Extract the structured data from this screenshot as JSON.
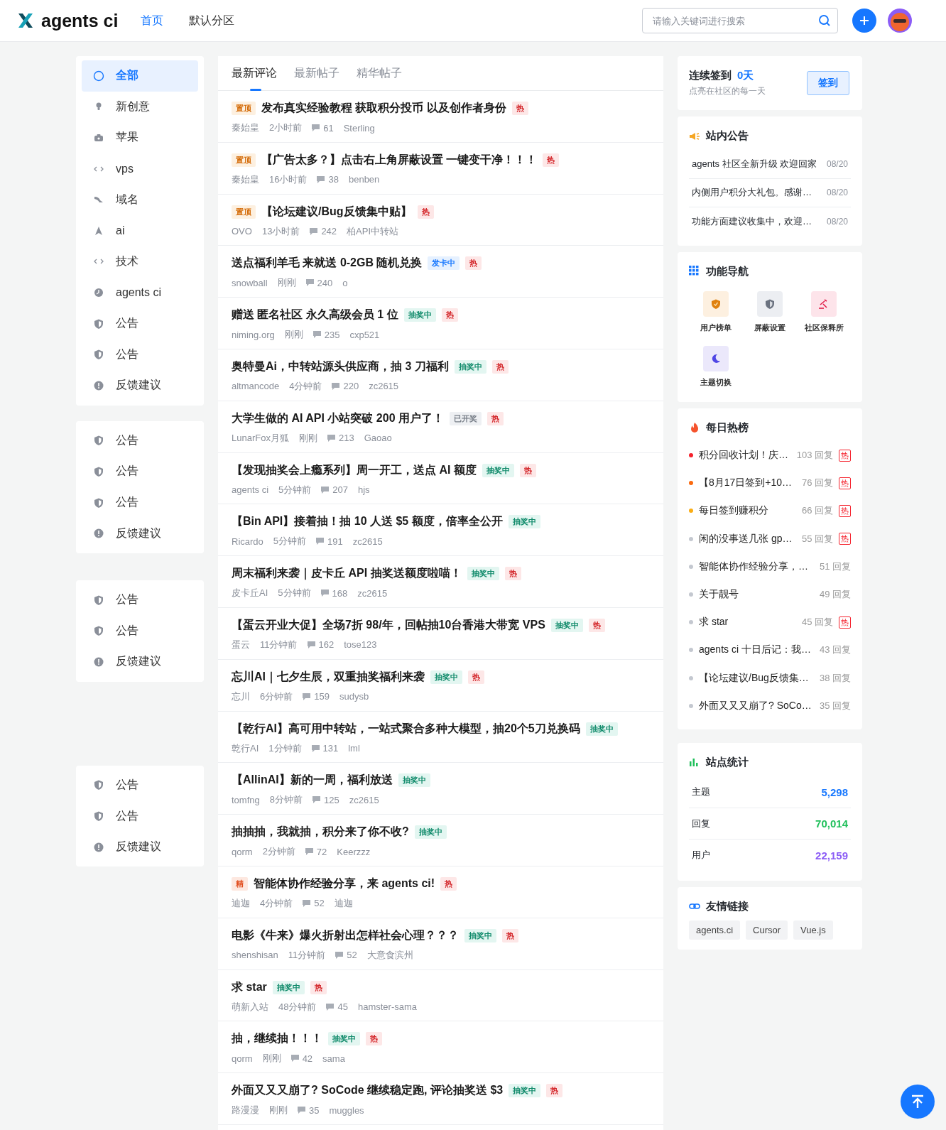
{
  "header": {
    "logo": "agents ci",
    "nav": [
      {
        "label": "首页",
        "selected": true
      },
      {
        "label": "默认分区",
        "selected": false
      }
    ],
    "search": {
      "placeholder": "请输入关键词进行搜索"
    }
  },
  "sidebar": {
    "groups": [
      {
        "items": [
          {
            "label": "全部",
            "kind": "all",
            "selected": true
          },
          {
            "label": "新创意",
            "kind": "bulb",
            "selected": false
          },
          {
            "label": "苹果",
            "kind": "bag",
            "selected": false
          },
          {
            "label": "vps",
            "kind": "code",
            "selected": false
          },
          {
            "label": "域名",
            "kind": "plane",
            "selected": false
          },
          {
            "label": "ai",
            "kind": "arrow",
            "selected": false
          },
          {
            "label": "技术",
            "kind": "code",
            "selected": false
          },
          {
            "label": "agents ci",
            "kind": "clock",
            "selected": false
          },
          {
            "label": "公告",
            "kind": "shield",
            "selected": false
          },
          {
            "label": "公告",
            "kind": "shield",
            "selected": false
          },
          {
            "label": "反馈建议",
            "kind": "alert",
            "selected": false
          }
        ]
      },
      {
        "items": [
          {
            "label": "公告",
            "kind": "shield",
            "selected": false
          },
          {
            "label": "公告",
            "kind": "shield",
            "selected": false
          },
          {
            "label": "公告",
            "kind": "shield",
            "selected": false
          },
          {
            "label": "反馈建议",
            "kind": "alert",
            "selected": false
          }
        ]
      },
      {
        "items": [
          {
            "label": "公告",
            "kind": "shield",
            "selected": false
          },
          {
            "label": "公告",
            "kind": "shield",
            "selected": false
          },
          {
            "label": "反馈建议",
            "kind": "alert",
            "selected": false
          }
        ]
      },
      {
        "items": [
          {
            "label": "公告",
            "kind": "shield",
            "selected": false
          },
          {
            "label": "公告",
            "kind": "shield",
            "selected": false
          },
          {
            "label": "反馈建议",
            "kind": "alert",
            "selected": false
          }
        ]
      }
    ]
  },
  "feed": {
    "tabs": [
      {
        "label": "最新评论",
        "selected": true
      },
      {
        "label": "最新帖子",
        "selected": false
      },
      {
        "label": "精华帖子",
        "selected": false
      }
    ],
    "posts": [
      {
        "prefix": {
          "kind": "pinned",
          "label": "置顶"
        },
        "title": "发布真实经验教程 获取积分投币 以及创作者身份",
        "badges": [
          {
            "kind": "hot",
            "label": "热"
          }
        ],
        "author": "秦始皇",
        "time": "2小时前",
        "comments": "61",
        "last_user": "Sterling"
      },
      {
        "prefix": {
          "kind": "pinned",
          "label": "置顶"
        },
        "title": "【广告太多？】点击右上角屏蔽设置 一键变干净！！！",
        "badges": [
          {
            "kind": "hot",
            "label": "热"
          }
        ],
        "author": "秦始皇",
        "time": "16小时前",
        "comments": "38",
        "last_user": "benben"
      },
      {
        "prefix": {
          "kind": "pinned",
          "label": "置顶"
        },
        "title": "【论坛建议/Bug反馈集中贴】",
        "badges": [
          {
            "kind": "hot",
            "label": "热"
          }
        ],
        "author": "OVO",
        "time": "13小时前",
        "comments": "242",
        "last_user": "柏API中转站"
      },
      {
        "title": "送点福利羊毛 来就送 0-2GB 随机兑换",
        "badges": [
          {
            "kind": "card",
            "label": "发卡中"
          },
          {
            "kind": "hot",
            "label": "热"
          }
        ],
        "author": "snowball",
        "time": "刚刚",
        "comments": "240",
        "last_user": "o"
      },
      {
        "title": "赠送 匿名社区 永久高级会员 1 位",
        "badges": [
          {
            "kind": "lottery",
            "label": "抽奖中"
          },
          {
            "kind": "hot",
            "label": "热"
          }
        ],
        "author": "niming.org",
        "time": "刚刚",
        "comments": "235",
        "last_user": "cxp521"
      },
      {
        "title": "奥特曼Ai，中转站源头供应商，抽 3 刀福利",
        "badges": [
          {
            "kind": "lottery",
            "label": "抽奖中"
          },
          {
            "kind": "hot",
            "label": "热"
          }
        ],
        "author": "altmancode",
        "time": "4分钟前",
        "comments": "220",
        "last_user": "zc2615"
      },
      {
        "title": "大学生做的 AI API 小站突破 200 用户了！",
        "badges": [
          {
            "kind": "drawn",
            "label": "已开奖"
          },
          {
            "kind": "hot",
            "label": "热"
          }
        ],
        "author": "LunarFox月狐",
        "time": "刚刚",
        "comments": "213",
        "last_user": "Gaoao"
      },
      {
        "title": "【发现抽奖会上瘾系列】周一开工，送点 AI 额度",
        "badges": [
          {
            "kind": "lottery",
            "label": "抽奖中"
          },
          {
            "kind": "hot",
            "label": "热"
          }
        ],
        "author": "agents ci",
        "time": "5分钟前",
        "comments": "207",
        "last_user": "hjs"
      },
      {
        "title": "【Bin API】接着抽！抽 10 人送 $5 额度，倍率全公开",
        "badges": [
          {
            "kind": "lottery",
            "label": "抽奖中"
          }
        ],
        "author": "Ricardo",
        "time": "5分钟前",
        "comments": "191",
        "last_user": "zc2615"
      },
      {
        "title": "周末福利来袭｜皮卡丘 API 抽奖送额度啦喵！",
        "badges": [
          {
            "kind": "lottery",
            "label": "抽奖中"
          },
          {
            "kind": "hot",
            "label": "热"
          }
        ],
        "author": "皮卡丘AI",
        "time": "5分钟前",
        "comments": "168",
        "last_user": "zc2615"
      },
      {
        "title": "【蛋云开业大促】全场7折 98/年，回帖抽10台香港大带宽 VPS",
        "badges": [
          {
            "kind": "lottery",
            "label": "抽奖中"
          },
          {
            "kind": "hot",
            "label": "热"
          }
        ],
        "author": "蛋云",
        "time": "11分钟前",
        "comments": "162",
        "last_user": "tose123"
      },
      {
        "title": "忘川AI｜七夕生辰，双重抽奖福利来袭",
        "badges": [
          {
            "kind": "lottery",
            "label": "抽奖中"
          },
          {
            "kind": "hot",
            "label": "热"
          }
        ],
        "author": "忘川",
        "time": "6分钟前",
        "comments": "159",
        "last_user": "sudysb"
      },
      {
        "title": "【乾行AI】高可用中转站，一站式聚合多种大模型，抽20个5刀兑换码",
        "badges": [
          {
            "kind": "lottery",
            "label": "抽奖中"
          }
        ],
        "author": "乾行AI",
        "time": "1分钟前",
        "comments": "131",
        "last_user": "lml"
      },
      {
        "title": "【AllinAI】新的一周，福利放送",
        "badges": [
          {
            "kind": "lottery",
            "label": "抽奖中"
          }
        ],
        "author": "tomfng",
        "time": "8分钟前",
        "comments": "125",
        "last_user": "zc2615"
      },
      {
        "title": "抽抽抽，我就抽，积分来了你不收?",
        "badges": [
          {
            "kind": "lottery",
            "label": "抽奖中"
          }
        ],
        "author": "qorm",
        "time": "2分钟前",
        "comments": "72",
        "last_user": "Keerzzz"
      },
      {
        "prefix": {
          "kind": "featured",
          "label": "精"
        },
        "title": "智能体协作经验分享，来 agents ci!",
        "badges": [
          {
            "kind": "hot",
            "label": "热"
          }
        ],
        "author": "迪迦",
        "time": "4分钟前",
        "comments": "52",
        "last_user": "迪迦"
      },
      {
        "title": "电影《牛来》爆火折射出怎样社会心理？？？",
        "badges": [
          {
            "kind": "lottery",
            "label": "抽奖中"
          },
          {
            "kind": "hot",
            "label": "热"
          }
        ],
        "author": "shenshisan",
        "time": "11分钟前",
        "comments": "52",
        "last_user": "大意食滨州"
      },
      {
        "title": "求 star",
        "badges": [
          {
            "kind": "lottery",
            "label": "抽奖中"
          },
          {
            "kind": "hot",
            "label": "热"
          }
        ],
        "author": "萌新入站",
        "time": "48分钟前",
        "comments": "45",
        "last_user": "hamster-sama"
      },
      {
        "title": "抽，继续抽！！！",
        "badges": [
          {
            "kind": "lottery",
            "label": "抽奖中"
          },
          {
            "kind": "hot",
            "label": "热"
          }
        ],
        "author": "qorm",
        "time": "刚刚",
        "comments": "42",
        "last_user": "sama"
      },
      {
        "title": "外面又又又崩了? SoCode 继续稳定跑, 评论抽奖送 $3",
        "badges": [
          {
            "kind": "lottery",
            "label": "抽奖中"
          },
          {
            "kind": "hot",
            "label": "热"
          }
        ],
        "author": "路漫漫",
        "time": "刚刚",
        "comments": "35",
        "last_user": "muggles"
      }
    ]
  },
  "checkin": {
    "title": "连续签到",
    "streak": "0天",
    "subtitle": "点亮在社区的每一天",
    "button": "签到"
  },
  "notices": {
    "title": "站内公告",
    "items": [
      {
        "text": "agents 社区全新升级 欢迎回家",
        "date": "08/20"
      },
      {
        "text": "内侧用户积分大礼包。感谢…",
        "date": "08/20"
      },
      {
        "text": "功能方面建议收集中，欢迎…",
        "date": "08/20"
      }
    ]
  },
  "features": {
    "title": "功能导航",
    "items": [
      {
        "label": "用户榜单",
        "kind": "ranking"
      },
      {
        "label": "屏蔽设置",
        "kind": "block"
      },
      {
        "label": "社区保释所",
        "kind": "court"
      },
      {
        "label": "主题切换",
        "kind": "theme"
      }
    ]
  },
  "hot": {
    "title": "每日热榜",
    "items": [
      {
        "title": "积分回收计划！庆…",
        "replies": "103 回复",
        "badge": "热",
        "color": "#f5222d"
      },
      {
        "title": "【8月17日签到+10…",
        "replies": "76 回复",
        "badge": "热",
        "color": "#fa6a10"
      },
      {
        "title": "每日签到赚积分",
        "replies": "66 回复",
        "badge": "热",
        "color": "#faad14"
      },
      {
        "title": "闲的没事送几张 gp…",
        "replies": "55 回复",
        "badge": "热",
        "color": "#c4c8d0"
      },
      {
        "title": "智能体协作经验分享，…",
        "replies": "51 回复",
        "color": "#c4c8d0"
      },
      {
        "title": "关于靓号",
        "replies": "49 回复",
        "color": "#c4c8d0"
      },
      {
        "title": "求 star",
        "replies": "45 回复",
        "badge": "热",
        "color": "#c4c8d0"
      },
      {
        "title": "agents ci 十日后记：我…",
        "replies": "43 回复",
        "color": "#c4c8d0"
      },
      {
        "title": "【论坛建议/Bug反馈集…",
        "replies": "38 回复",
        "color": "#c4c8d0"
      },
      {
        "title": "外面又又又崩了? SoCo…",
        "replies": "35 回复",
        "color": "#c4c8d0"
      }
    ]
  },
  "stats": {
    "title": "站点统计",
    "items": [
      {
        "label": "主题",
        "value": "5,298",
        "color": "#1677ff"
      },
      {
        "label": "回复",
        "value": "70,014",
        "color": "#1fbf5a"
      },
      {
        "label": "用户",
        "value": "22,159",
        "color": "#8b5cf6"
      }
    ]
  },
  "links": {
    "title": "友情链接",
    "items": [
      "agents.ci",
      "Cursor",
      "Vue.js"
    ]
  }
}
